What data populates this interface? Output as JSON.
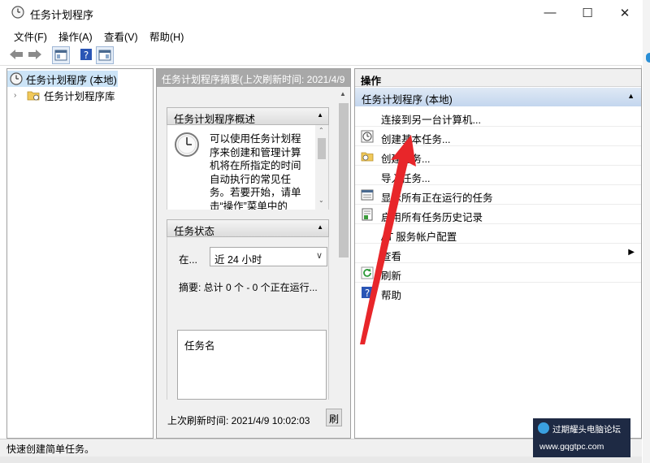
{
  "window": {
    "title": "任务计划程序",
    "controls": {
      "minimize": "—",
      "maximize": "☐",
      "close": "✕"
    }
  },
  "menu": [
    "文件(F)",
    "操作(A)",
    "查看(V)",
    "帮助(H)"
  ],
  "tree": {
    "root": "任务计划程序 (本地)",
    "child": "任务计划程序库"
  },
  "middle": {
    "header": "任务计划程序摘要(上次刷新时间: 2021/4/9",
    "overview": {
      "title": "任务计划程序概述",
      "lines": [
        "可以使用任务计划程",
        "序来创建和管理计算",
        "机将在所指定的时间",
        "自动执行的常见任",
        "务。若要开始，请单",
        "击“操作”菜单中的"
      ]
    },
    "status": {
      "title": "任务状态",
      "filter_label": "在...",
      "filter_value": "近 24 小时",
      "summary": "摘要: 总计 0 个 - 0 个正在运行...",
      "list_header": "任务名"
    },
    "footer": {
      "last_refresh": "上次刷新时间: 2021/4/9 10:02:03",
      "refresh_button": "刷"
    }
  },
  "actions": {
    "header": "操作",
    "group": "任务计划程序 (本地)",
    "items": [
      {
        "label": "连接到另一台计算机...",
        "icon": "none"
      },
      {
        "label": "创建基本任务...",
        "icon": "clock-wizard-icon"
      },
      {
        "label": "创建任务...",
        "icon": "folder-clock-icon"
      },
      {
        "label": "导入任务...",
        "icon": "none"
      },
      {
        "label": "显示所有正在运行的任务",
        "icon": "running-tasks-icon"
      },
      {
        "label": "启用所有任务历史记录",
        "icon": "history-icon"
      },
      {
        "label": "AT 服务帐户配置",
        "icon": "none"
      },
      {
        "label": "查看",
        "icon": "none"
      },
      {
        "label": "刷新",
        "icon": "refresh-icon"
      },
      {
        "label": "帮助",
        "icon": "help-icon"
      }
    ]
  },
  "statusbar": "快速创建简单任务。",
  "watermark": {
    "line1": "过期耀头电脑论坛",
    "line2": "www.gqgtpc.com"
  },
  "colors": {
    "accent_red": "#e8262a",
    "header_grey": "#a8a8a8",
    "selection_blue": "#c3d6ee"
  }
}
